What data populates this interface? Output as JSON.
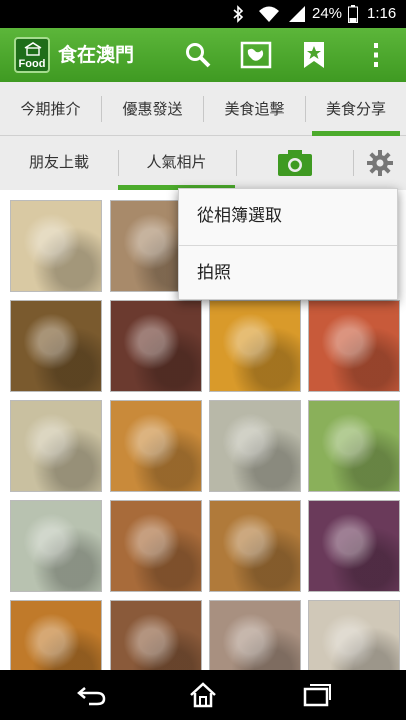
{
  "status_bar": {
    "battery_percent": "24%",
    "time": "1:16"
  },
  "action_bar": {
    "app_title": "食在澳門",
    "logo_text": "Food",
    "icons": [
      "search-icon",
      "map-icon",
      "bookmark-star-icon",
      "overflow-menu-icon"
    ]
  },
  "tabs": [
    {
      "label": "今期推介",
      "active": false
    },
    {
      "label": "優惠發送",
      "active": false
    },
    {
      "label": "美食追擊",
      "active": false
    },
    {
      "label": "美食分享",
      "active": true
    }
  ],
  "subtabs": [
    {
      "label": "朋友上載",
      "active": false
    },
    {
      "label": "人氣相片",
      "active": true
    },
    {
      "icon": "camera-icon",
      "active": false
    },
    {
      "icon": "settings-gear-icon",
      "active": false
    }
  ],
  "popup_menu": {
    "items": [
      {
        "label": "從相簿選取"
      },
      {
        "label": "拍照"
      }
    ]
  },
  "photos": [
    {
      "subject": "congee with fried egg",
      "color": "#d9c9a3"
    },
    {
      "subject": "coffee and plate",
      "color": "#a88a6a"
    },
    {
      "subject": "hidden",
      "color": "#ffffff"
    },
    {
      "subject": "hidden",
      "color": "#ffffff"
    },
    {
      "subject": "burger with fries",
      "color": "#7a5a2e"
    },
    {
      "subject": "decorated cake",
      "color": "#6b3a2f"
    },
    {
      "subject": "mango dessert",
      "color": "#d99a2a"
    },
    {
      "subject": "pizza",
      "color": "#c85a3a"
    },
    {
      "subject": "pizza with vegetables",
      "color": "#c9c0a0"
    },
    {
      "subject": "egg tart",
      "color": "#c98a3a"
    },
    {
      "subject": "noodle soup",
      "color": "#b8b8a8"
    },
    {
      "subject": "salad",
      "color": "#8ab05a"
    },
    {
      "subject": "rice rolls",
      "color": "#b8c2b0"
    },
    {
      "subject": "dim sum",
      "color": "#a86b3a"
    },
    {
      "subject": "burger",
      "color": "#b07a3a"
    },
    {
      "subject": "purple dessert",
      "color": "#6a3a5a"
    },
    {
      "subject": "waffle",
      "color": "#c07a2a"
    },
    {
      "subject": "seafood",
      "color": "#8a5a3a"
    },
    {
      "subject": "parfait",
      "color": "#a89080"
    },
    {
      "subject": "plated dish",
      "color": "#d0c8b8"
    }
  ],
  "nav_bar": {
    "icons": [
      "back-icon",
      "home-icon",
      "recent-apps-icon"
    ]
  }
}
